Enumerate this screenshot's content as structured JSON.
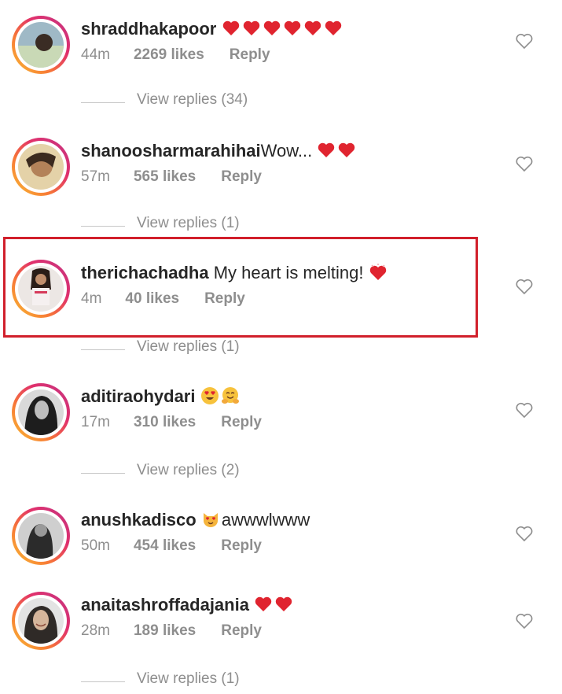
{
  "comments": [
    {
      "username": "shraddhakapoor",
      "text": "",
      "emoji": [
        "heart",
        "heart",
        "heart",
        "heart",
        "heart",
        "heart"
      ],
      "time": "44m",
      "likes": "2269 likes",
      "reply": "Reply",
      "replies": "View replies (34)"
    },
    {
      "username": "shanoosharmarahihai",
      "text": "Wow...",
      "emoji": [
        "heart",
        "heart"
      ],
      "time": "57m",
      "likes": "565 likes",
      "reply": "Reply",
      "replies": "View replies (1)"
    },
    {
      "username": "therichachadha",
      "text": "My heart is melting!",
      "emoji": [
        "sparkling-heart"
      ],
      "time": "4m",
      "likes": "40 likes",
      "reply": "Reply",
      "replies": "View replies (1)"
    },
    {
      "username": "aditiraohydari",
      "text": "",
      "emoji": [
        "heart-eyes-face",
        "hugging-face"
      ],
      "time": "17m",
      "likes": "310 likes",
      "reply": "Reply",
      "replies": "View replies (2)"
    },
    {
      "username": "anushkadisco",
      "text": "awwwlwww",
      "emoji": [
        "heart-eyes-cat"
      ],
      "time": "50m",
      "likes": "454 likes",
      "reply": "Reply",
      "replies": ""
    },
    {
      "username": "anaitashroffadajania",
      "text": "",
      "emoji": [
        "heart",
        "heart"
      ],
      "time": "28m",
      "likes": "189 likes",
      "reply": "Reply",
      "replies": "View replies (1)"
    }
  ],
  "colors": {
    "highlight": "#d11f2b",
    "heart": "#e0242f",
    "meta": "#8e8e8e"
  }
}
